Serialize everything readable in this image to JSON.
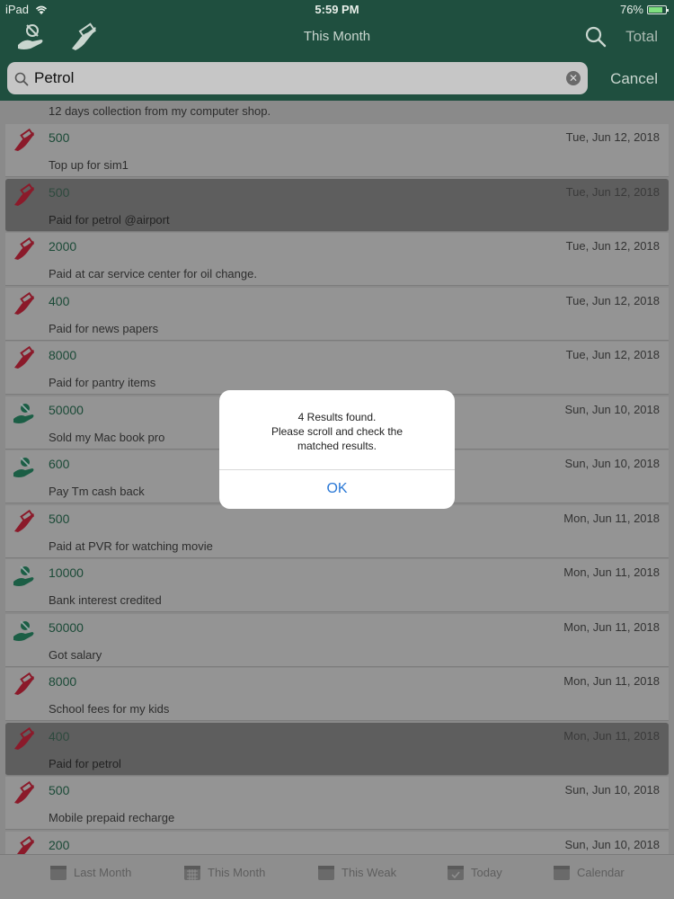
{
  "status": {
    "device": "iPad",
    "time": "5:59 PM",
    "battery": "76%"
  },
  "nav": {
    "title": "This Month",
    "total_label": "Total"
  },
  "search": {
    "value": "Petrol",
    "cancel_label": "Cancel"
  },
  "list": {
    "first_desc": "12 days collection from my computer shop.",
    "rows": [
      {
        "type": "expense",
        "amount": "500",
        "date": "Tue, Jun 12, 2018",
        "desc": "Top up for sim1",
        "highlight": false
      },
      {
        "type": "expense",
        "amount": "500",
        "date": "Tue, Jun 12, 2018",
        "desc": "Paid for petrol @airport",
        "highlight": true
      },
      {
        "type": "expense",
        "amount": "2000",
        "date": "Tue, Jun 12, 2018",
        "desc": "Paid at car service center for oil change.",
        "highlight": false
      },
      {
        "type": "expense",
        "amount": "400",
        "date": "Tue, Jun 12, 2018",
        "desc": "Paid for news papers",
        "highlight": false
      },
      {
        "type": "expense",
        "amount": "8000",
        "date": "Tue, Jun 12, 2018",
        "desc": "Paid for pantry items",
        "highlight": false
      },
      {
        "type": "income",
        "amount": "50000",
        "date": "Sun, Jun 10, 2018",
        "desc": "Sold my Mac book pro",
        "highlight": false
      },
      {
        "type": "income",
        "amount": "600",
        "date": "Sun, Jun 10, 2018",
        "desc": "Pay Tm cash back",
        "highlight": false
      },
      {
        "type": "expense",
        "amount": "500",
        "date": "Mon, Jun 11, 2018",
        "desc": "Paid at PVR for watching movie",
        "highlight": false
      },
      {
        "type": "income",
        "amount": "10000",
        "date": "Mon, Jun 11, 2018",
        "desc": "Bank interest credited",
        "highlight": false
      },
      {
        "type": "income",
        "amount": "50000",
        "date": "Mon, Jun 11, 2018",
        "desc": "Got salary",
        "highlight": false
      },
      {
        "type": "expense",
        "amount": "8000",
        "date": "Mon, Jun 11, 2018",
        "desc": "School fees for my kids",
        "highlight": false
      },
      {
        "type": "expense",
        "amount": "400",
        "date": "Mon, Jun 11, 2018",
        "desc": "Paid for petrol",
        "highlight": true
      },
      {
        "type": "expense",
        "amount": "500",
        "date": "Sun, Jun 10, 2018",
        "desc": "Mobile prepaid recharge",
        "highlight": false
      },
      {
        "type": "expense",
        "amount": "200",
        "date": "Sun, Jun 10, 2018",
        "desc": "",
        "highlight": false
      }
    ]
  },
  "tabs": [
    {
      "label": "Last Month",
      "icon": "calendar-icon"
    },
    {
      "label": "This Month",
      "icon": "calendar-grid-icon"
    },
    {
      "label": "This Weak",
      "icon": "calendar-week-icon"
    },
    {
      "label": "Today",
      "icon": "calendar-check-icon"
    },
    {
      "label": "Calendar",
      "icon": "calendar-icon"
    }
  ],
  "alert": {
    "line1": "4 Results found.",
    "line2": "Please scroll and check the",
    "line3": "matched results.",
    "ok_label": "OK"
  },
  "colors": {
    "header": "#1f4f3f",
    "income": "#1b5e45",
    "expense": "#8b1a2a",
    "link": "#2a78d6"
  }
}
